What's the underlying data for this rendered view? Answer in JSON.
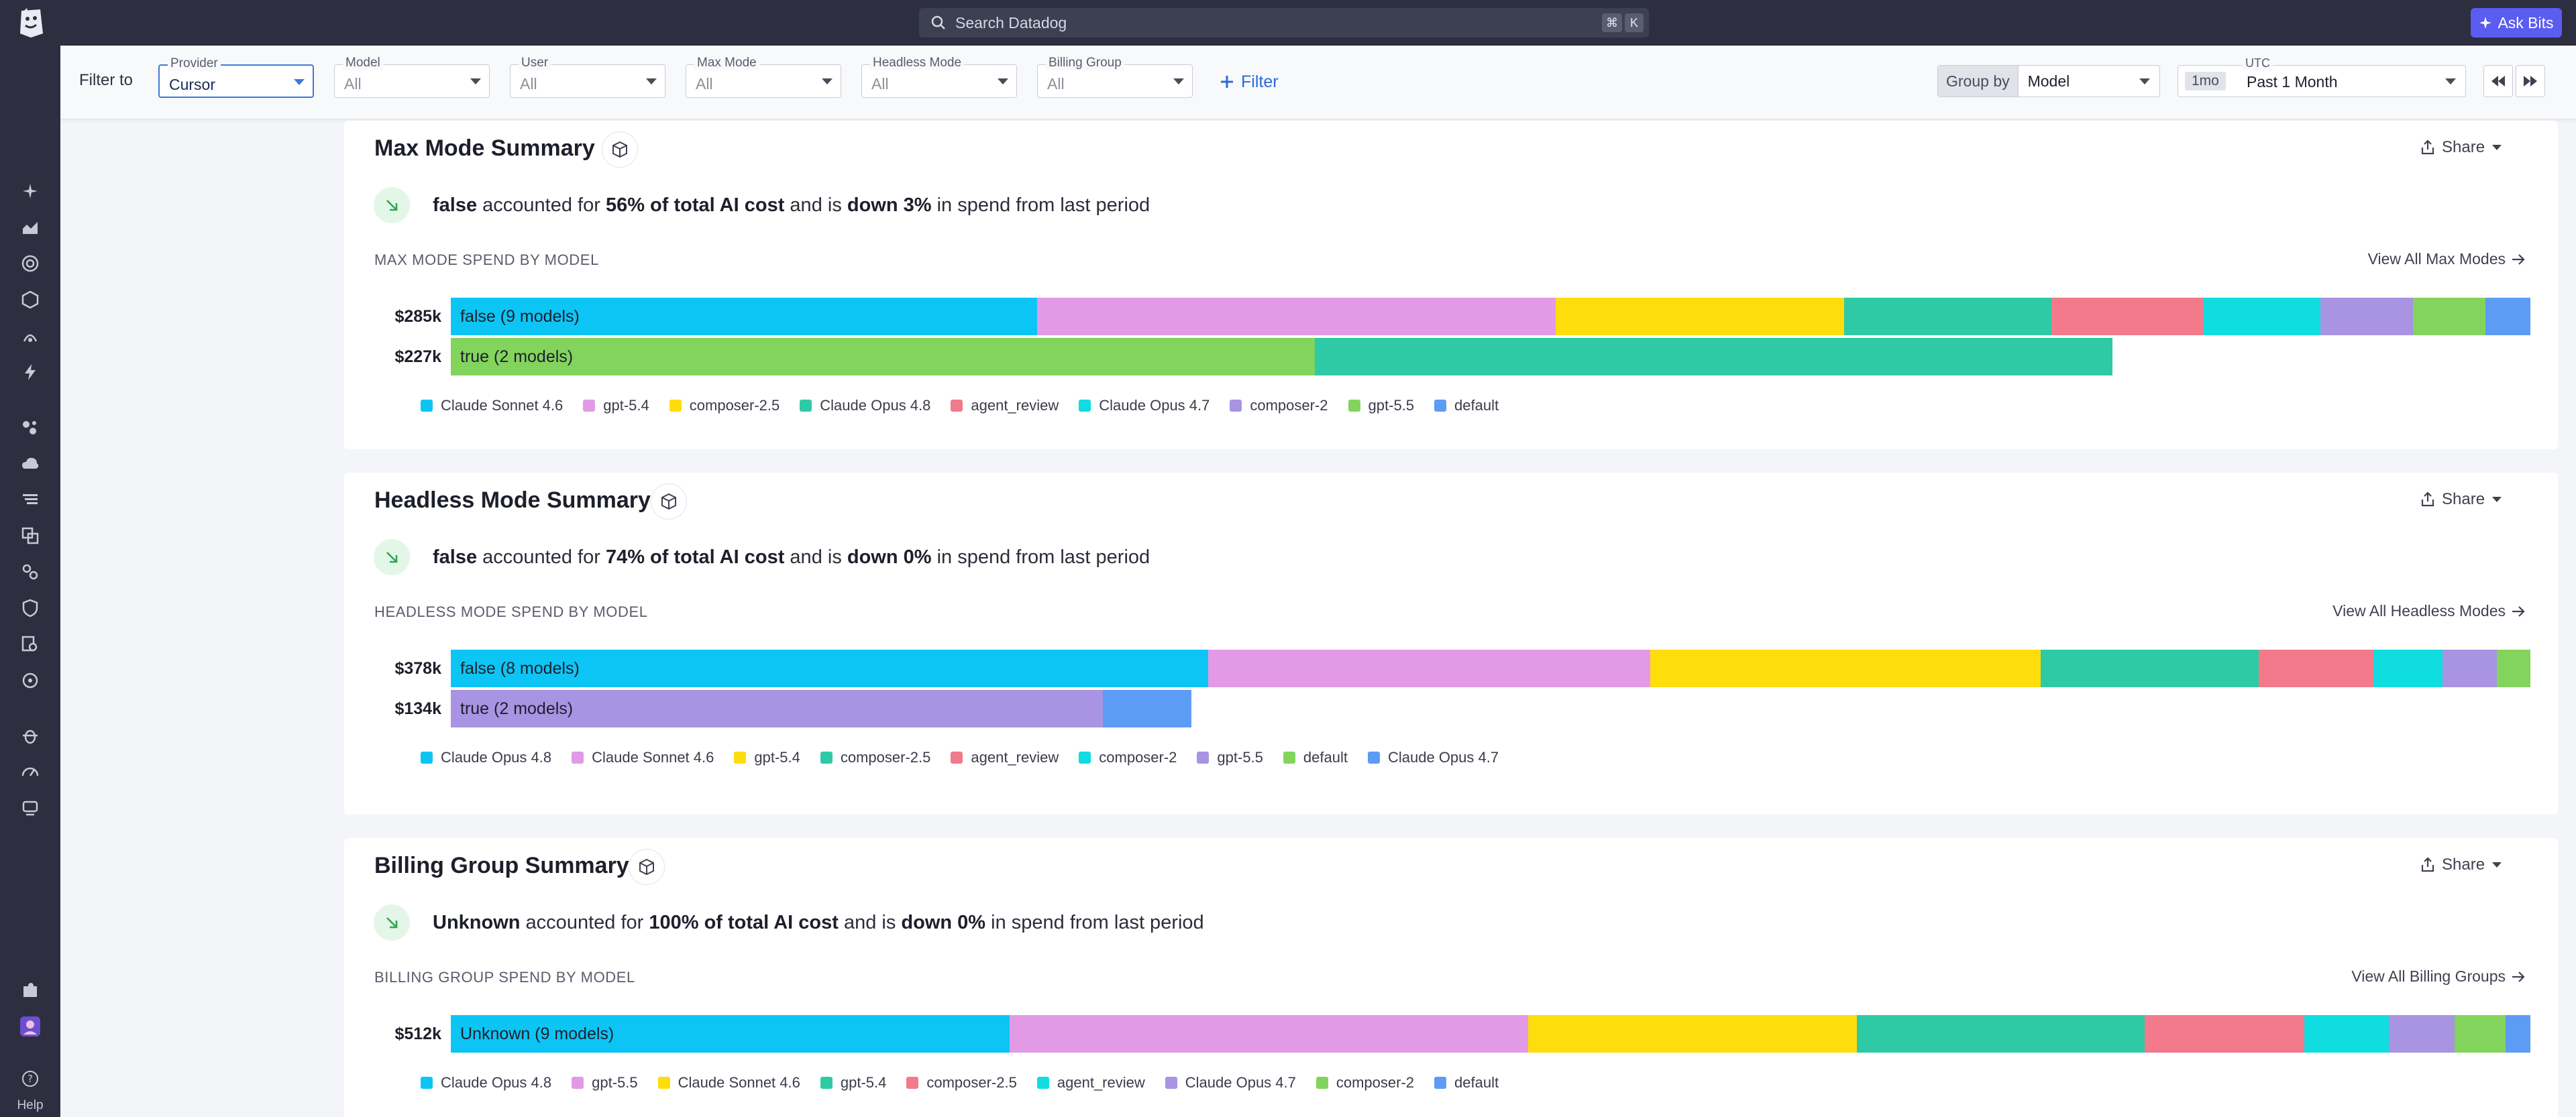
{
  "colors": {
    "sky": "#0cc5f5",
    "pink": "#e29ae6",
    "yellow": "#fedd0c",
    "teal": "#2ecaa5",
    "rose": "#f27a8b",
    "cyan": "#10dde0",
    "lavender": "#a993e3",
    "green": "#83d45c",
    "blue": "#5c9cf5"
  },
  "topbar": {
    "search_label": "Search Datadog",
    "kbd_cmd": "⌘",
    "kbd_k": "K",
    "ask_bits": "Ask Bits"
  },
  "nav": {
    "help": "Help"
  },
  "filters": {
    "filter_to": "Filter to",
    "add_filter": "Filter",
    "items": [
      {
        "label": "Provider",
        "value": "Cursor"
      },
      {
        "label": "Model",
        "value": "All"
      },
      {
        "label": "User",
        "value": "All"
      },
      {
        "label": "Max Mode",
        "value": "All"
      },
      {
        "label": "Headless Mode",
        "value": "All"
      },
      {
        "label": "Billing Group",
        "value": "All"
      }
    ],
    "group_by_label": "Group by",
    "group_by_value": "Model",
    "timezone": "UTC",
    "duration": "1mo",
    "time_value": "Past 1 Month"
  },
  "cards": [
    {
      "title": "Max Mode Summary",
      "share": "Share",
      "summary": {
        "subject": "false",
        "pre": " accounted for ",
        "pct": "56% of total AI cost",
        "mid": " and is ",
        "change": "down 3%",
        "post": " in spend from last period"
      },
      "section_label": "MAX MODE SPEND BY MODEL",
      "view_all": "View All Max Modes",
      "bars": [
        {
          "value_label": "$285k",
          "seg_label": "false (9 models)",
          "segments": [
            {
              "c": "sky",
              "w": 0.282
            },
            {
              "c": "pink",
              "w": 0.2494
            },
            {
              "c": "yellow",
              "w": 0.1386
            },
            {
              "c": "teal",
              "w": 0.0998
            },
            {
              "c": "rose",
              "w": 0.073
            },
            {
              "c": "cyan",
              "w": 0.0566
            },
            {
              "c": "lavender",
              "w": 0.0444
            },
            {
              "c": "green",
              "w": 0.0347
            },
            {
              "c": "blue",
              "w": 0.0215
            }
          ]
        },
        {
          "value_label": "$227k",
          "seg_label": "true (2 models)",
          "segments": [
            {
              "c": "green",
              "w": 0.4154
            },
            {
              "c": "teal",
              "w": 0.3836
            }
          ]
        }
      ],
      "legend": [
        {
          "c": "sky",
          "name": "Claude Sonnet 4.6"
        },
        {
          "c": "pink",
          "name": "gpt-5.4"
        },
        {
          "c": "yellow",
          "name": "composer-2.5"
        },
        {
          "c": "teal",
          "name": "Claude Opus 4.8"
        },
        {
          "c": "rose",
          "name": "agent_review"
        },
        {
          "c": "cyan",
          "name": "Claude Opus 4.7"
        },
        {
          "c": "lavender",
          "name": "composer-2"
        },
        {
          "c": "green",
          "name": "gpt-5.5"
        },
        {
          "c": "blue",
          "name": "default"
        }
      ]
    },
    {
      "title": "Headless Mode Summary",
      "share": "Share",
      "summary": {
        "subject": "false",
        "pre": " accounted for ",
        "pct": "74% of total AI cost",
        "mid": " and is ",
        "change": "down 0%",
        "post": " in spend from last period"
      },
      "section_label": "HEADLESS MODE SPEND BY MODEL",
      "view_all": "View All Headless Modes",
      "bars": [
        {
          "value_label": "$378k",
          "seg_label": "false (8 models)",
          "segments": [
            {
              "c": "sky",
              "w": 0.3642
            },
            {
              "c": "pink",
              "w": 0.2126
            },
            {
              "c": "yellow",
              "w": 0.1878
            },
            {
              "c": "teal",
              "w": 0.1047
            },
            {
              "c": "rose",
              "w": 0.0553
            },
            {
              "c": "cyan",
              "w": 0.0332
            },
            {
              "c": "lavender",
              "w": 0.0261
            },
            {
              "c": "green",
              "w": 0.0161
            }
          ]
        },
        {
          "value_label": "$134k",
          "seg_label": "true (2 models)",
          "segments": [
            {
              "c": "lavender",
              "w": 0.3136
            },
            {
              "c": "blue",
              "w": 0.0427
            }
          ]
        }
      ],
      "legend": [
        {
          "c": "sky",
          "name": "Claude Opus 4.8"
        },
        {
          "c": "pink",
          "name": "Claude Sonnet 4.6"
        },
        {
          "c": "yellow",
          "name": "gpt-5.4"
        },
        {
          "c": "teal",
          "name": "composer-2.5"
        },
        {
          "c": "rose",
          "name": "agent_review"
        },
        {
          "c": "cyan",
          "name": "composer-2"
        },
        {
          "c": "lavender",
          "name": "gpt-5.5"
        },
        {
          "c": "green",
          "name": "default"
        },
        {
          "c": "blue",
          "name": "Claude Opus 4.7"
        }
      ]
    },
    {
      "title": "Billing Group Summary",
      "share": "Share",
      "summary": {
        "subject": "Unknown",
        "pre": " accounted for ",
        "pct": "100% of total AI cost",
        "mid": " and is ",
        "change": "down 0%",
        "post": " in spend from last period"
      },
      "section_label": "BILLING GROUP SPEND BY MODEL",
      "view_all": "View All Billing Groups",
      "bars": [
        {
          "value_label": "$512k",
          "seg_label": "Unknown (9 models)",
          "segments": [
            {
              "c": "sky",
              "w": 0.2688
            },
            {
              "c": "pink",
              "w": 0.2494
            },
            {
              "c": "yellow",
              "w": 0.1581
            },
            {
              "c": "teal",
              "w": 0.1383
            },
            {
              "c": "rose",
              "w": 0.0767
            },
            {
              "c": "cyan",
              "w": 0.0407
            },
            {
              "c": "lavender",
              "w": 0.0316
            },
            {
              "c": "green",
              "w": 0.0245
            },
            {
              "c": "blue",
              "w": 0.0119
            }
          ]
        }
      ],
      "legend": [
        {
          "c": "sky",
          "name": "Claude Opus 4.8"
        },
        {
          "c": "pink",
          "name": "gpt-5.5"
        },
        {
          "c": "yellow",
          "name": "Claude Sonnet 4.6"
        },
        {
          "c": "teal",
          "name": "gpt-5.4"
        },
        {
          "c": "rose",
          "name": "composer-2.5"
        },
        {
          "c": "cyan",
          "name": "agent_review"
        },
        {
          "c": "lavender",
          "name": "Claude Opus 4.7"
        },
        {
          "c": "green",
          "name": "composer-2"
        },
        {
          "c": "blue",
          "name": "default"
        }
      ]
    }
  ]
}
